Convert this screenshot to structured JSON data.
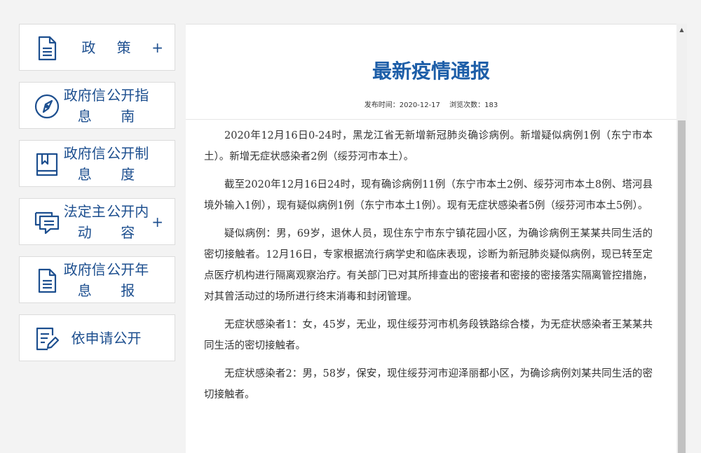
{
  "sidebar": {
    "items": [
      {
        "label": "政  策",
        "icon": "document-icon",
        "plus": "+"
      },
      {
        "label_line1": "政府信息",
        "label_line2": "公开指南",
        "icon": "compass-icon"
      },
      {
        "label_line1": "政府信息",
        "label_line2": "公开制度",
        "icon": "book-icon"
      },
      {
        "label_line1": "法定主动",
        "label_line2": "公开内容",
        "icon": "chat-icon",
        "plus": "+"
      },
      {
        "label_line1": "政府信息",
        "label_line2": "公开年报",
        "icon": "document-icon"
      },
      {
        "label_line1": "依申请",
        "label_line2": "公开",
        "icon": "edit-form-icon"
      }
    ]
  },
  "article": {
    "title": "最新疫情通报",
    "publish_label": "发布时间：2020-12-17",
    "views_label": "浏览次数：183",
    "paragraphs": [
      "2020年12月16日0-24时，黑龙江省无新增新冠肺炎确诊病例。新增疑似病例1例（东宁市本土）。新增无症状感染者2例（绥芬河市本土）。",
      "截至2020年12月16日24时，现有确诊病例11例（东宁市本土2例、绥芬河市本土8例、塔河县境外输入1例），现有疑似病例1例（东宁市本土1例）。现有无症状感染者5例（绥芬河市本土5例）。",
      "疑似病例：男，69岁，退休人员，现住东宁市东宁镇花园小区，为确诊病例王某某共同生活的密切接触者。12月16日，专家根据流行病学史和临床表现，诊断为新冠肺炎疑似病例，现已转至定点医疗机构进行隔离观察治疗。有关部门已对其所排查出的密接者和密接的密接落实隔离管控措施，对其曾活动过的场所进行终末消毒和封闭管理。",
      "无症状感染者1：女，45岁，无业，现住绥芬河市机务段铁路综合楼，为无症状感染者王某某共同生活的密切接触者。",
      "无症状感染者2：男，58岁，保安，现住绥芬河市迎泽丽都小区，为确诊病例刘某共同生活的密切接触者。"
    ]
  },
  "scrollbar": {
    "up_arrow": "▲"
  },
  "colors": {
    "accent": "#1d5ea8",
    "nav_text": "#1d4f8f",
    "background": "#f3f3f3"
  }
}
